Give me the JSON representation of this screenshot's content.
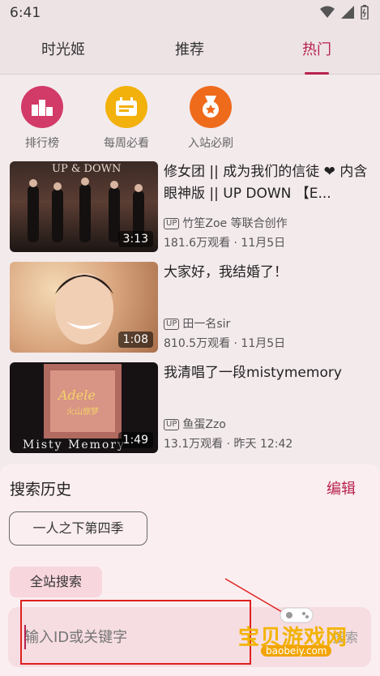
{
  "status_bar": {
    "time": "6:41"
  },
  "tabs": [
    {
      "label": "时光姬",
      "active": false
    },
    {
      "label": "推荐",
      "active": false
    },
    {
      "label": "热门",
      "active": true
    }
  ],
  "shortcuts": [
    {
      "label": "排行榜",
      "icon": "ranking-podium-icon",
      "color": "#d23a68"
    },
    {
      "label": "每周必看",
      "icon": "weekly-calendar-icon",
      "color": "#f2b10b"
    },
    {
      "label": "入站必刷",
      "icon": "medal-icon",
      "color": "#ef6b1c"
    }
  ],
  "videos": [
    {
      "title": "修女团 || 成为我们的信徒 ❤ 内含眼神版 || UP DOWN 【E...",
      "thumb_text": "UP & DOWN",
      "duration": "3:13",
      "author": "竹笙Zoe 等联合创作",
      "stats": "181.6万观看 · 11月5日"
    },
    {
      "title": "大家好，我结婚了！",
      "thumb_text": "",
      "duration": "1:08",
      "author": "田一名sir",
      "stats": "810.5万观看 · 11月5日"
    },
    {
      "title": "我清唱了一段mistymemory",
      "thumb_text": "Misty Memory",
      "duration": "1:49",
      "author": "鱼蛋Zzo",
      "stats": "13.1万观看 · 昨天 12:42"
    }
  ],
  "up_badge": "UP",
  "search_sheet": {
    "title": "搜索历史",
    "edit_label": "编辑",
    "history": [
      "一人之下第四季"
    ],
    "scope_label": "全站搜索",
    "input_placeholder": "输入ID或关键字",
    "search_button": "搜索"
  },
  "watermark": {
    "text": "宝贝游戏网",
    "url": "baobeiy.com"
  }
}
